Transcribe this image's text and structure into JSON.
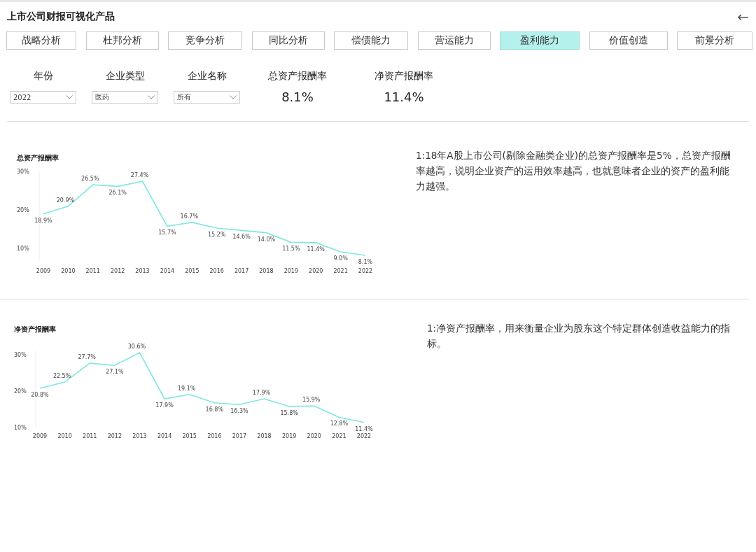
{
  "header": {
    "title": "上市公司财报可视化产品",
    "back_icon": "←"
  },
  "tabs": [
    {
      "label": "战略分析",
      "selected": false
    },
    {
      "label": "杜邦分析",
      "selected": false
    },
    {
      "label": "竞争分析",
      "selected": false
    },
    {
      "label": "同比分析",
      "selected": false
    },
    {
      "label": "偿债能力",
      "selected": false
    },
    {
      "label": "营运能力",
      "selected": false
    },
    {
      "label": "盈利能力",
      "selected": true
    },
    {
      "label": "价值创造",
      "selected": false
    },
    {
      "label": "前景分析",
      "selected": false
    }
  ],
  "filters": [
    {
      "label": "年份",
      "value": "2022"
    },
    {
      "label": "企业类型",
      "value": "医药"
    },
    {
      "label": "企业名称",
      "value": "所有"
    }
  ],
  "kpis": [
    {
      "label": "总资产报酬率",
      "value": "8.1%"
    },
    {
      "label": "净资产报酬率",
      "value": "11.4%"
    }
  ],
  "sections": [
    {
      "chart_data": {
        "type": "line",
        "title": "总资产报酬率",
        "categories": [
          "2009",
          "2010",
          "2011",
          "2012",
          "2013",
          "2014",
          "2015",
          "2016",
          "2017",
          "2018",
          "2019",
          "2020",
          "2021",
          "2022"
        ],
        "series": [
          {
            "color": "#7de8e0",
            "values": [
              18.9,
              20.9,
              26.5,
              26.1,
              27.4,
              15.7,
              16.7,
              15.2,
              14.6,
              14.0,
              11.5,
              11.4,
              9.0,
              8.1
            ]
          }
        ],
        "value_labels": [
          "18.9%",
          "20.9%",
          "26.5%",
          "26.1%",
          "27.4%",
          "15.7%",
          "16.7%",
          "15.2%",
          "14.6%",
          "14.0%",
          "11.5%",
          "11.4%",
          "9.0%",
          "8.1%"
        ],
        "ylim": [
          7,
          30
        ],
        "yticks": [
          {
            "value": 10,
            "label": "10%"
          },
          {
            "value": 20,
            "label": "20%"
          },
          {
            "value": 30,
            "label": "30%"
          }
        ]
      },
      "note": "1:18年A股上市公司(剔除金融类企业)的总资产报酬率是5%，总资产报酬率越高，说明企业资产的运用效率越高，也就意味者企业的资产的盈利能力越强。"
    },
    {
      "chart_data": {
        "type": "line",
        "title": "净资产报酬率",
        "categories": [
          "2009",
          "2010",
          "2011",
          "2012",
          "2013",
          "2014",
          "2015",
          "2016",
          "2017",
          "2018",
          "2019",
          "2020",
          "2021",
          "2022"
        ],
        "series": [
          {
            "color": "#7de8e0",
            "values": [
              20.8,
              22.5,
              27.7,
              27.1,
              30.6,
              17.9,
              19.1,
              16.8,
              16.3,
              17.9,
              15.8,
              15.9,
              12.8,
              11.4
            ]
          }
        ],
        "value_labels": [
          "20.8%",
          "22.5%",
          "27.7%",
          "27.1%",
          "30.6%",
          "17.9%",
          "19.1%",
          "16.8%",
          "16.3%",
          "17.9%",
          "15.8%",
          "15.9%",
          "12.8%",
          "11.4%"
        ],
        "ylim": [
          10,
          31
        ],
        "yticks": [
          {
            "value": 10,
            "label": "10%"
          },
          {
            "value": 20,
            "label": "20%"
          },
          {
            "value": 30,
            "label": "30%"
          }
        ]
      },
      "note": "1:净资产报酬率，用来衡量企业为股东这个特定群体创造收益能力的指标。"
    }
  ]
}
